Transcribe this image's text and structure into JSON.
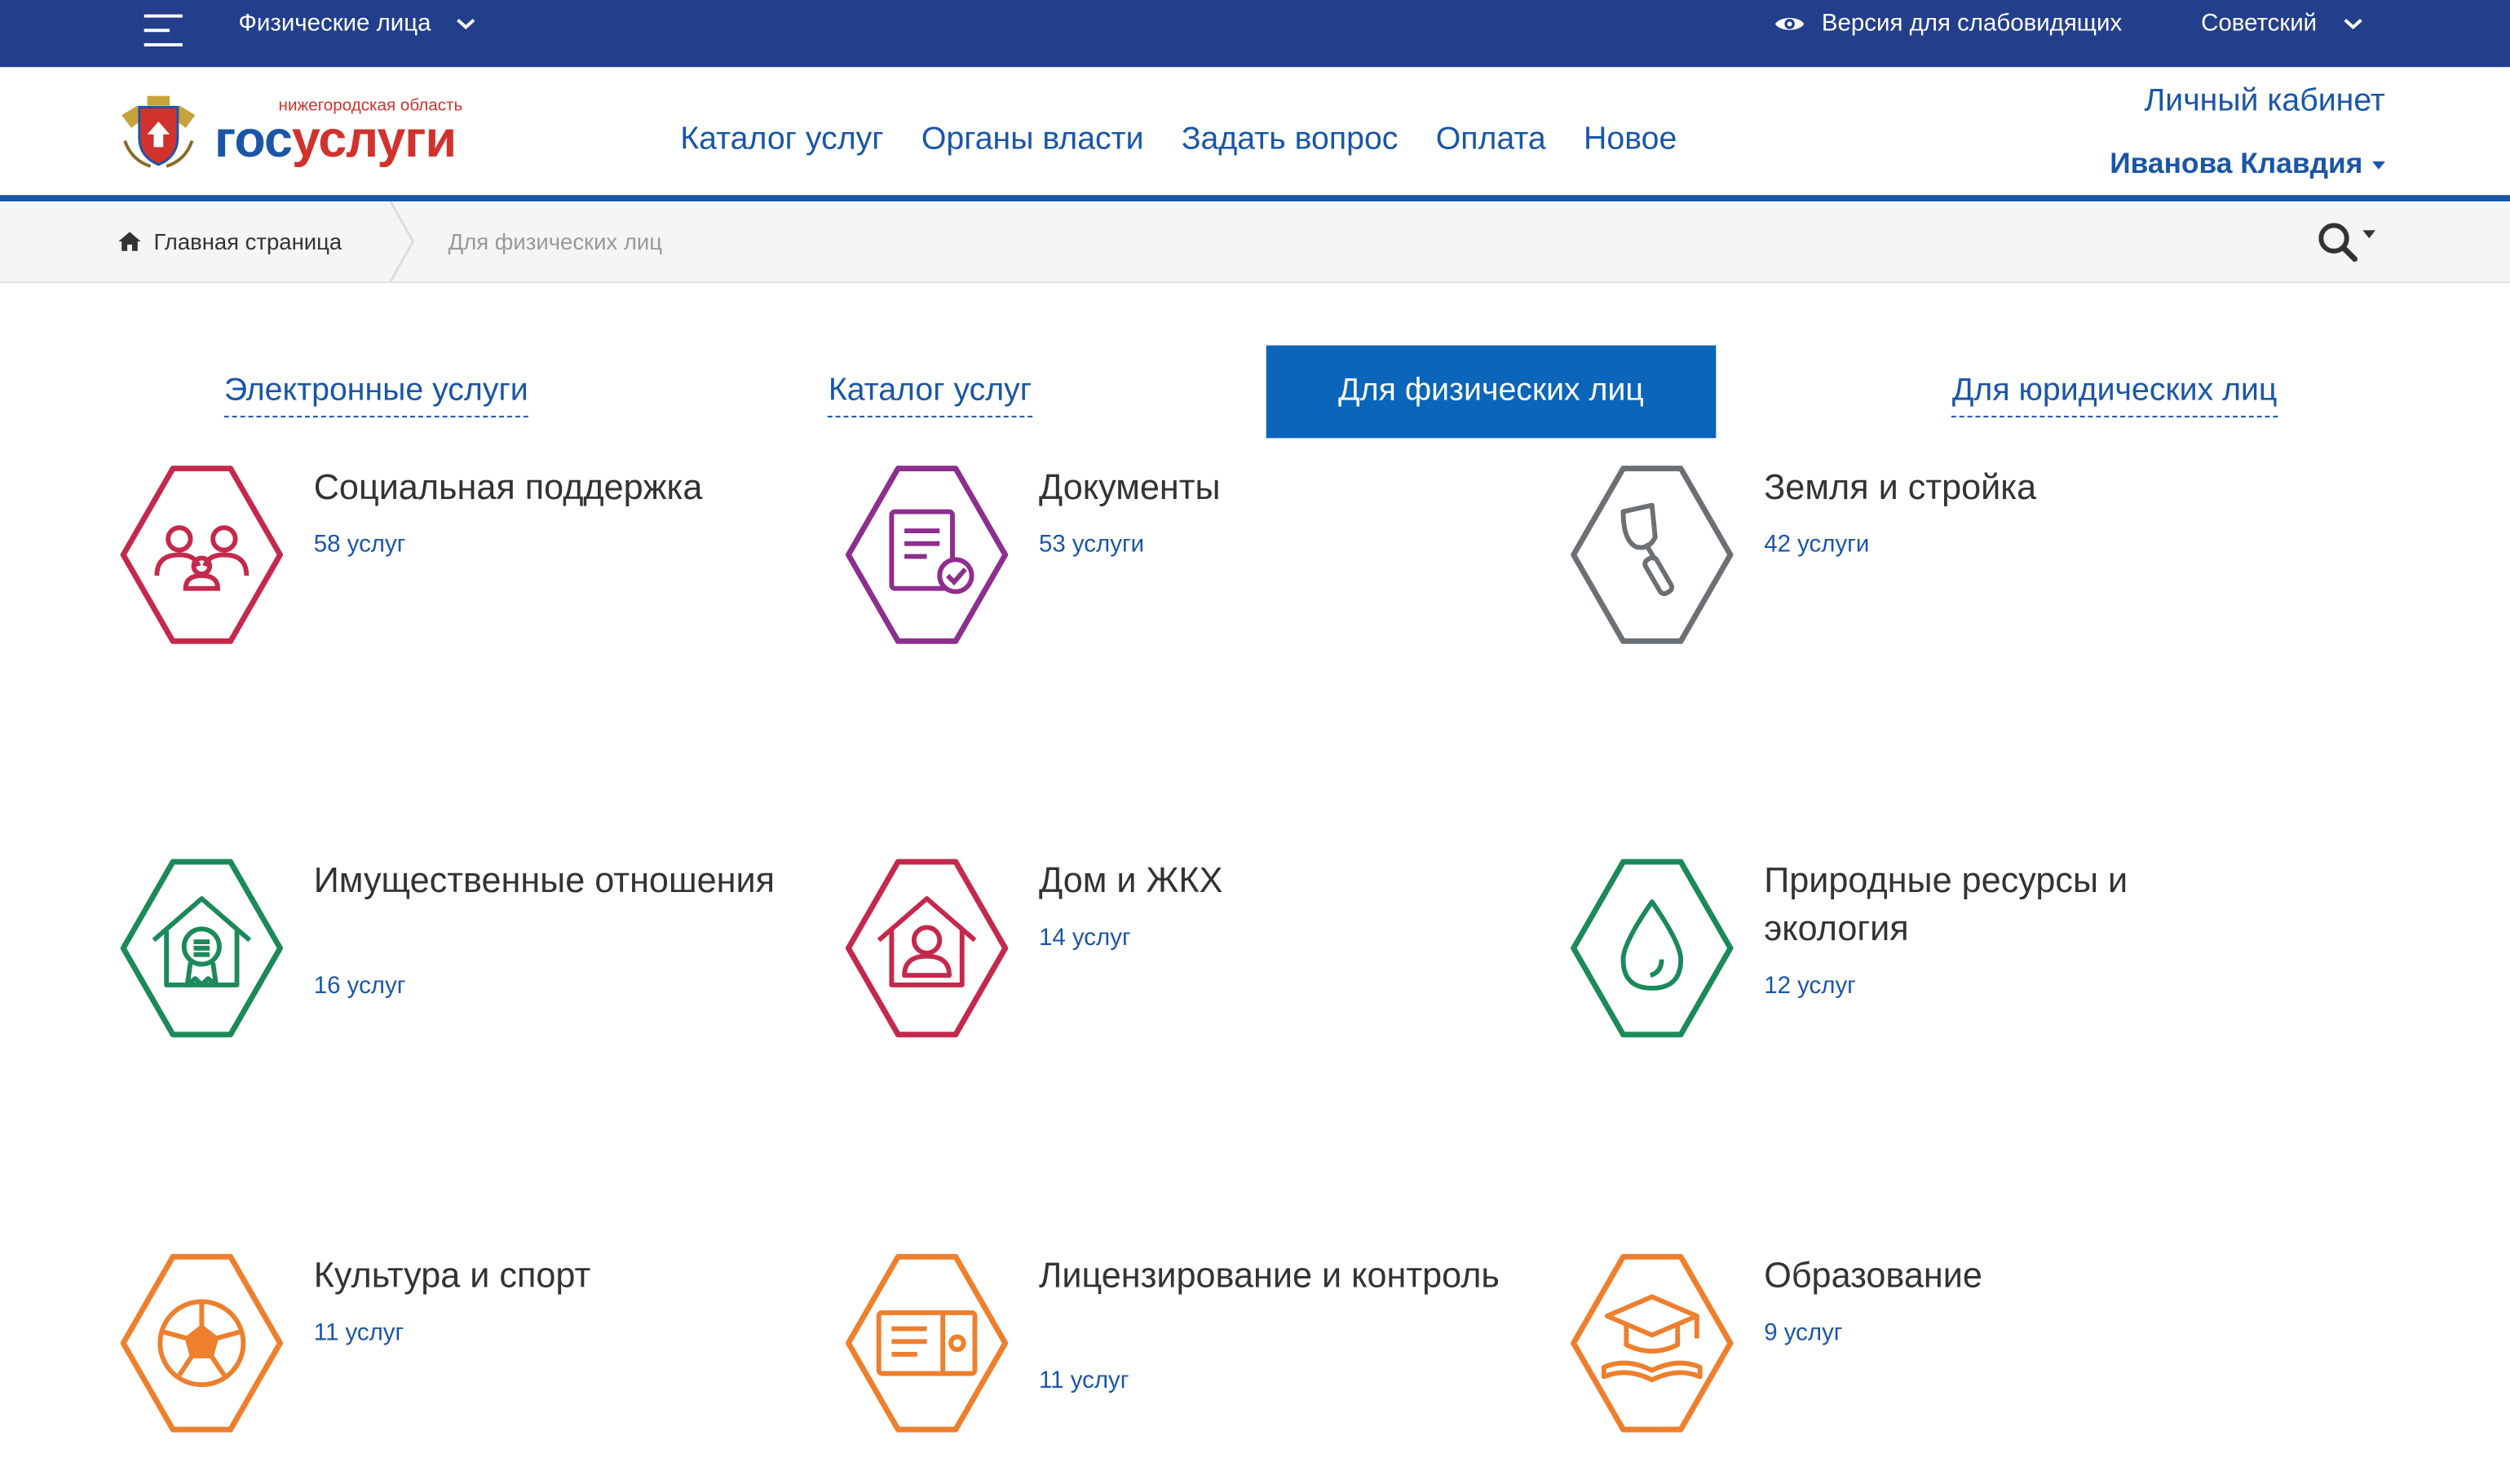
{
  "topbar": {
    "audience_select": "Физические лица",
    "accessibility_link": "Версия для слабовидящих",
    "district_select": "Советский"
  },
  "logo": {
    "region": "нижегородская область",
    "name_part1": "гос",
    "name_part2": "услуги"
  },
  "nav": {
    "items": [
      "Каталог услуг",
      "Органы власти",
      "Задать вопрос",
      "Оплата",
      "Новое"
    ]
  },
  "account": {
    "cabinet_link": "Личный кабинет",
    "user_name": "Иванова Клавдия"
  },
  "breadcrumb": {
    "home": "Главная страница",
    "current": "Для физических лиц"
  },
  "tabs": [
    {
      "label": "Электронные услуги",
      "active": false
    },
    {
      "label": "Каталог услуг",
      "active": false
    },
    {
      "label": "Для физических лиц",
      "active": true
    },
    {
      "label": "Для юридических лиц",
      "active": false
    }
  ],
  "categories": [
    {
      "title": "Социальная поддержка",
      "count": "58 услуг",
      "icon": "people-icon",
      "color": "#c4294b"
    },
    {
      "title": "Документы",
      "count": "53 услуги",
      "icon": "document-check-icon",
      "color": "#8e2e8f"
    },
    {
      "title": "Земля и стройка",
      "count": "42 услуги",
      "icon": "trowel-icon",
      "color": "#6b7075"
    },
    {
      "title": "Имущественные отношения",
      "count": "16 услуг",
      "icon": "house-certificate-icon",
      "color": "#1b8a5a"
    },
    {
      "title": "Дом и ЖКХ",
      "count": "14 услуг",
      "icon": "house-person-icon",
      "color": "#c4294b"
    },
    {
      "title": "Природные ресурсы и экология",
      "count": "12 услуг",
      "icon": "water-drop-icon",
      "color": "#1b8a5a"
    },
    {
      "title": "Культура и спорт",
      "count": "11 услуг",
      "icon": "soccer-ball-icon",
      "color": "#ee7f2d"
    },
    {
      "title": "Лицензирование и контроль",
      "count": "11 услуг",
      "icon": "license-icon",
      "color": "#ee7f2d"
    },
    {
      "title": "Образование",
      "count": "9 услуг",
      "icon": "graduation-cap-icon",
      "color": "#ee7f2d"
    }
  ],
  "colors": {
    "topbar": "#233e8b",
    "brand_blue": "#1a56a8",
    "brand_red": "#d2322d",
    "active_tab": "#0b65b8"
  }
}
